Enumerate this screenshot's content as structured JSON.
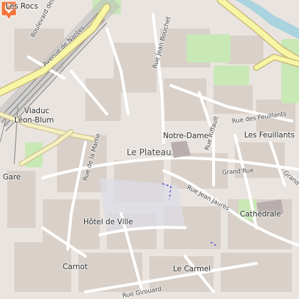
{
  "labels": {
    "center_place": "Le Plateau",
    "notre_dame": "Notre-Dame",
    "les_feuillants": "Les Feuillants",
    "cathedrale": "Cathédrale",
    "hotel_de_ville": "Hôtel de Ville",
    "carnot": "Carnot",
    "le_carmel": "Le Carmel",
    "les_rocs": "Les Rocs",
    "viaduc_line1": "Viaduc",
    "viaduc_line2": "Léon-Blum",
    "gare": "Gare"
  },
  "streets": {
    "avenue_de_nantes": "Avenue de Nantes",
    "boulevard_des": "Boulevard des",
    "rue_jean_bouchet": "Rue Jean Bouchet",
    "rue_de_la_marne": "Rue de la Marne",
    "rue_des_feuillants": "Rue des Feuillants",
    "rue_riffault": "Rue Riffault",
    "grand_rue_1": "Grand'Rue",
    "grand_rue_2": "Grand",
    "rue_jean_jaures": "Rue Jean Jaurès",
    "rue_girouard": "Rue Girouard"
  },
  "icons": {
    "marker": "map-pin-icon",
    "marker_color": "#f4743b"
  },
  "colors": {
    "land": "#e9e4df",
    "buildings": "#d9d0c9",
    "park": "#c8e8b5",
    "major_road": "#f7f6a4",
    "railway": "#9a9a9a",
    "water": "#a9d3df",
    "pedestrian": "#dddde8"
  }
}
